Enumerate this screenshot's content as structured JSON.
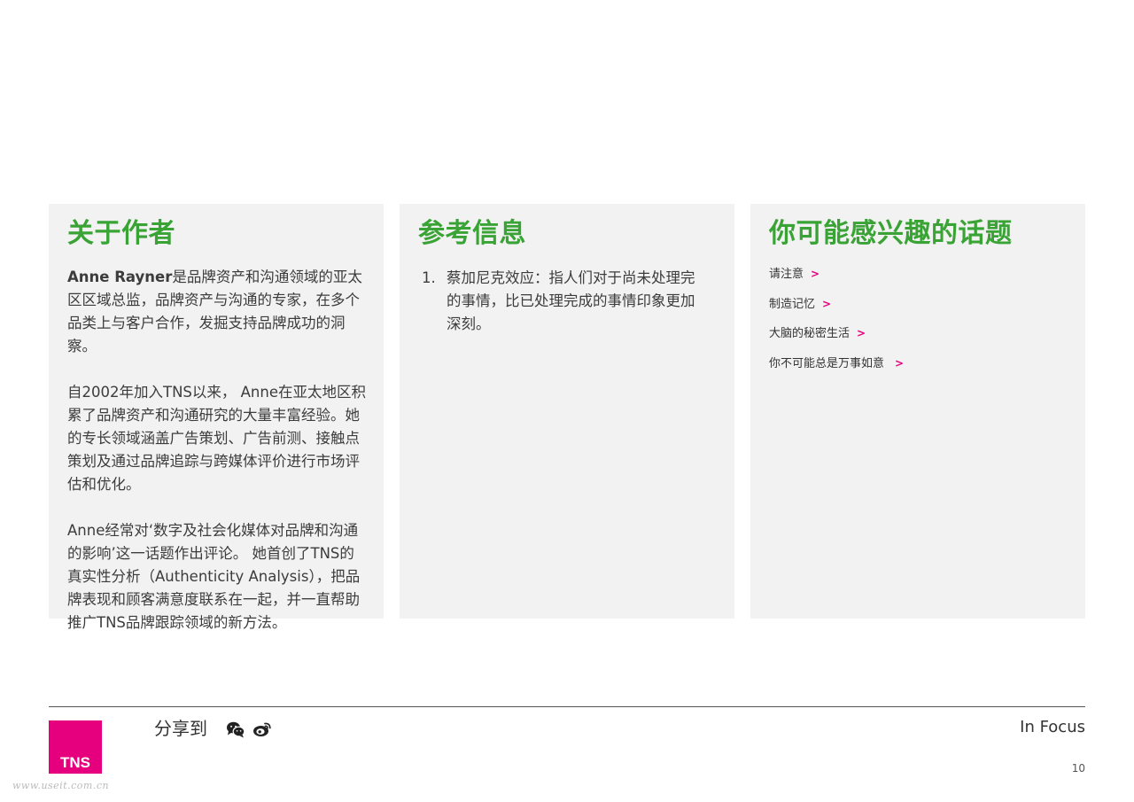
{
  "about": {
    "title": "关于作者",
    "author_name": "Anne Rayner",
    "paragraph1_rest": "是品牌资产和沟通领域的亚太区区域总监，品牌资产与沟通的专家，在多个品类上与客户合作，发掘支持品牌成功的洞察。",
    "paragraph2": "自2002年加入TNS以来， Anne在亚太地区积累了品牌资产和沟通研究的大量丰富经验。她的专长领域涵盖广告策划、广告前测、接触点策划及通过品牌追踪与跨媒体评价进行市场评估和优化。",
    "paragraph3": "Anne经常对‘数字及社会化媒体对品牌和沟通的影响’这一话题作出评论。 她首创了TNS的真实性分析（Authenticity Analysis），把品牌表现和顾客满意度联系在一起，并一直帮助推广TNS品牌跟踪领域的新方法。"
  },
  "references": {
    "title": "参考信息",
    "items": [
      {
        "number": "1.",
        "text": "蔡加尼克效应：指人们对于尚未处理完的事情，比已处理完成的事情印象更加深刻。"
      }
    ]
  },
  "topics": {
    "title": "你可能感兴趣的话题",
    "arrow": ">",
    "items": [
      {
        "label": "请注意"
      },
      {
        "label": "制造记忆"
      },
      {
        "label": "大脑的秘密生活"
      },
      {
        "label": "你不可能总是万事如意"
      }
    ]
  },
  "footer": {
    "logo_text": "TNS",
    "share_label": "分享到",
    "section_name": "In Focus",
    "page_number": "10",
    "watermark": "www.useit.com.cn"
  },
  "colors": {
    "accent_green": "#3aa335",
    "brand_magenta": "#e6007e",
    "panel_bg": "#f2f2f2"
  },
  "icons": {
    "share": [
      "wechat-icon",
      "weibo-icon"
    ]
  }
}
